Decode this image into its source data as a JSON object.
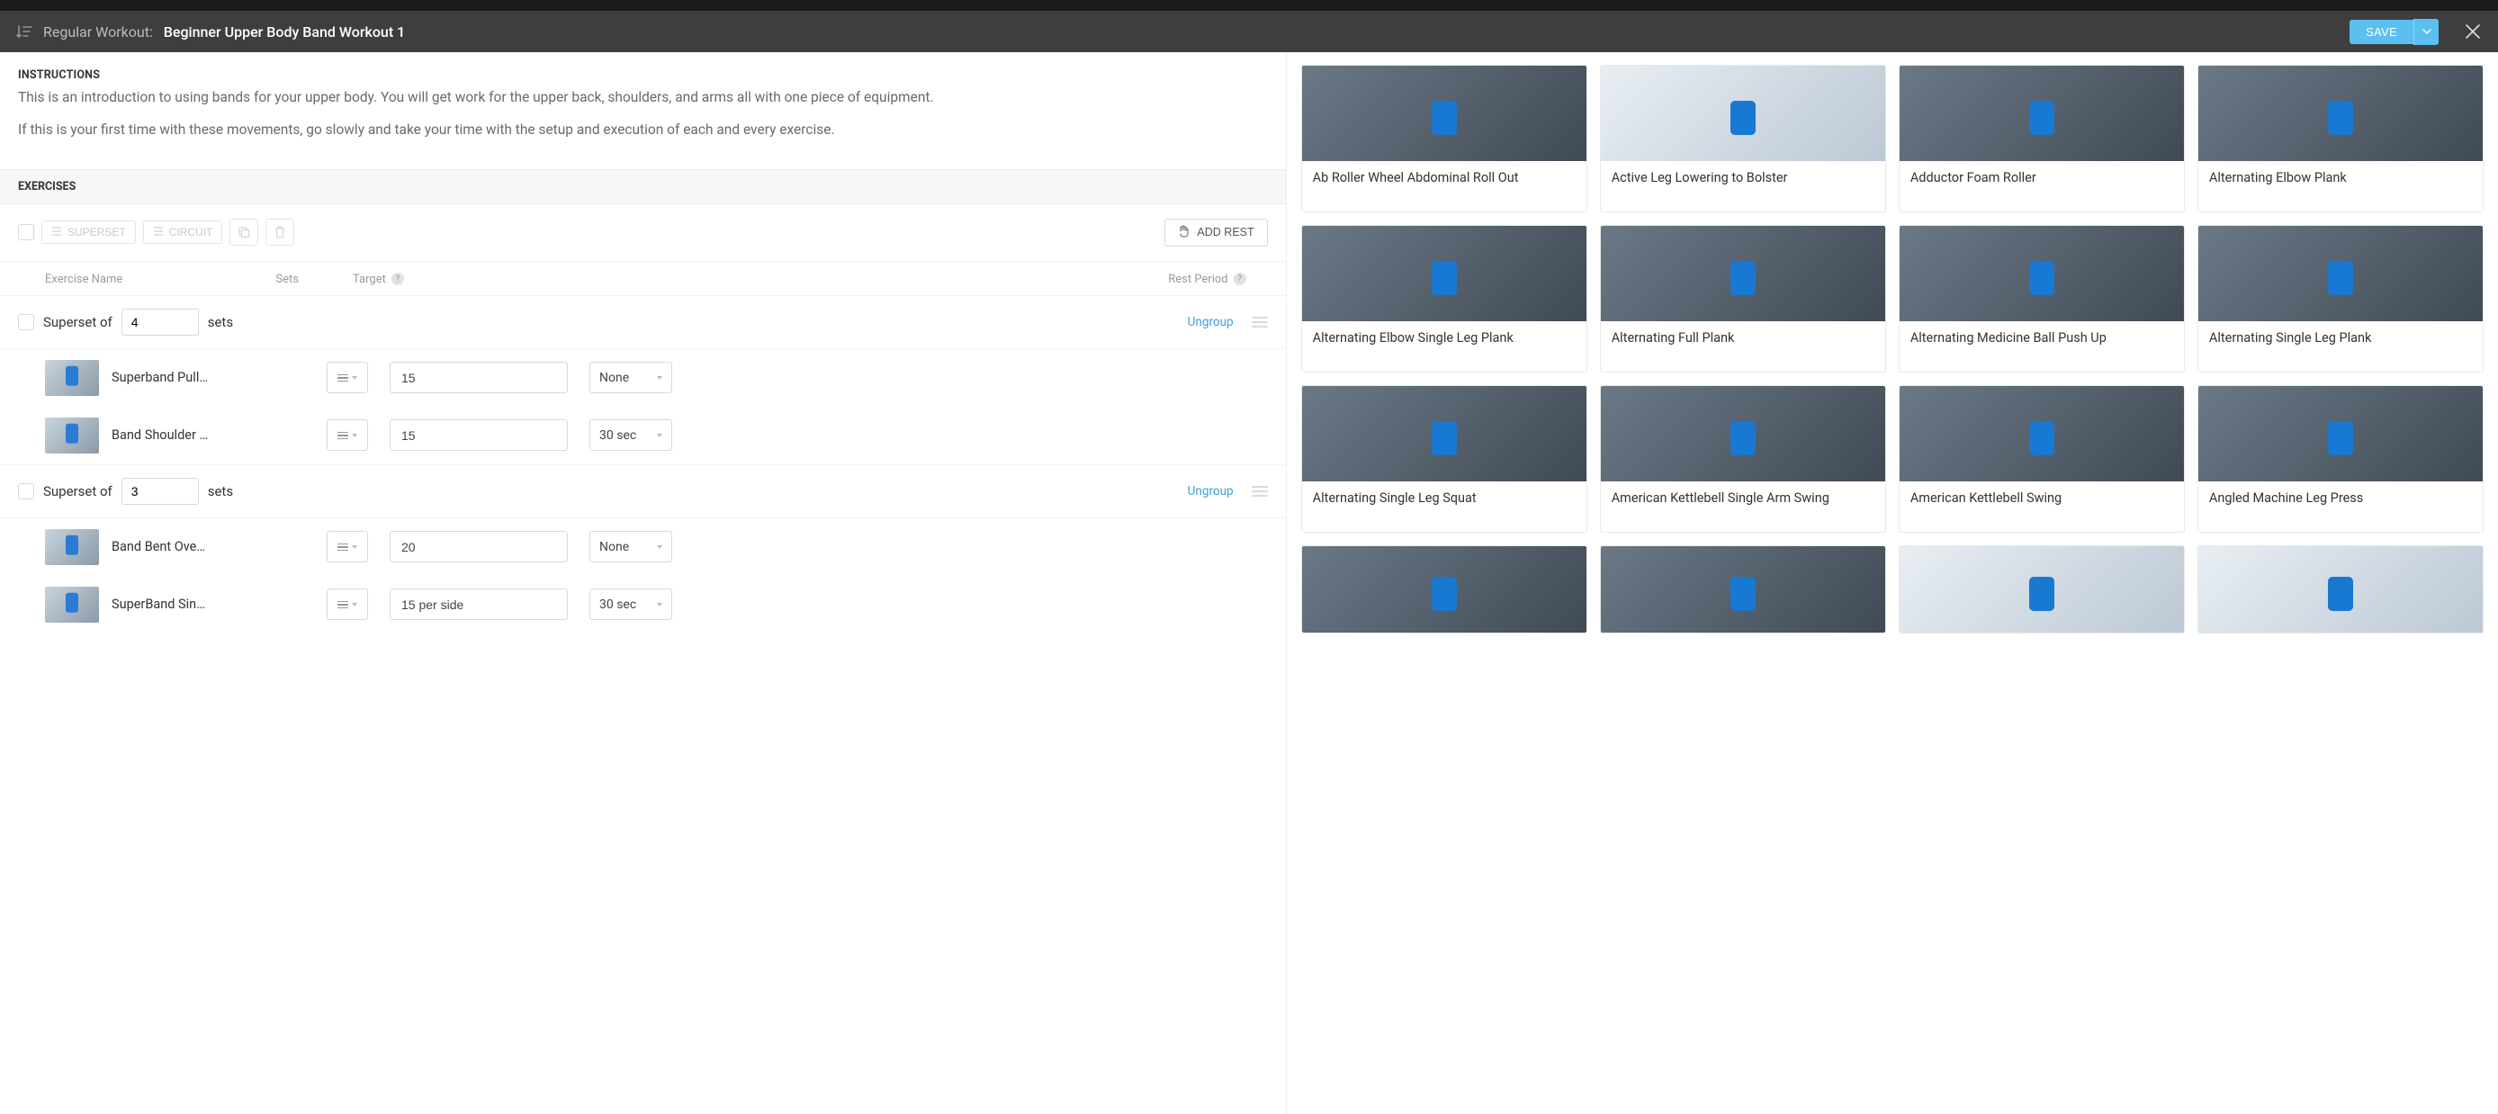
{
  "titlebar": {
    "prefix": "Regular Workout:",
    "title": "Beginner Upper Body Band Workout 1",
    "save_label": "SAVE"
  },
  "instructions": {
    "label": "INSTRUCTIONS",
    "p1": "This is an introduction to using bands for your upper body. You will get work for the upper back, shoulders, and arms all with one piece of equipment.",
    "p2": "If this is your first time with these movements, go slowly and take your time with the setup and execution of each and every exercise."
  },
  "exercises_section": {
    "label": "EXERCISES",
    "superset_btn": "SUPERSET",
    "circuit_btn": "CIRCUIT",
    "add_rest_btn": "ADD REST",
    "columns": {
      "name": "Exercise Name",
      "sets": "Sets",
      "target": "Target",
      "rest": "Rest Period"
    }
  },
  "supersets": [
    {
      "prefix": "Superset of",
      "count": "4",
      "suffix": "sets",
      "ungroup": "Ungroup",
      "rows": [
        {
          "name": "Superband Pull…",
          "target": "15",
          "rest": "None"
        },
        {
          "name": "Band Shoulder …",
          "target": "15",
          "rest": "30 sec"
        }
      ]
    },
    {
      "prefix": "Superset of",
      "count": "3",
      "suffix": "sets",
      "ungroup": "Ungroup",
      "rows": [
        {
          "name": "Band Bent Ove…",
          "target": "20",
          "rest": "None"
        },
        {
          "name": "SuperBand Sin…",
          "target": "15 per side",
          "rest": "30 sec"
        }
      ]
    }
  ],
  "library": {
    "row0": [
      {
        "title": "Ab Roller Wheel Abdominal Roll Out"
      },
      {
        "title": "Active Leg Lowering to Bolster"
      },
      {
        "title": "Adductor Foam Roller"
      },
      {
        "title": "Alternating Elbow Plank"
      }
    ],
    "row1": [
      {
        "title": "Alternating Elbow Single Leg Plank"
      },
      {
        "title": "Alternating Full Plank"
      },
      {
        "title": "Alternating Medicine Ball Push Up"
      },
      {
        "title": "Alternating Single Leg Plank"
      }
    ],
    "row2": [
      {
        "title": "Alternating Single Leg Squat"
      },
      {
        "title": "American Kettlebell Single Arm Swing"
      },
      {
        "title": "American Kettlebell Swing"
      },
      {
        "title": "Angled Machine Leg Press"
      }
    ],
    "row3": [
      {
        "title": ""
      },
      {
        "title": ""
      },
      {
        "title": ""
      },
      {
        "title": ""
      }
    ]
  }
}
